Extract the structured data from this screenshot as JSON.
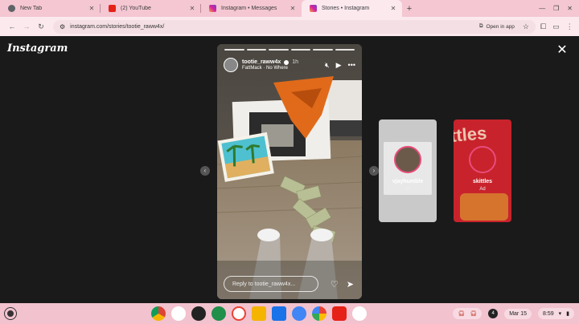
{
  "tabs": [
    {
      "title": "New Tab",
      "color": "#5f6368",
      "active": false
    },
    {
      "title": "(2) YouTube",
      "color": "#e62117",
      "active": false
    },
    {
      "title": "Instagram • Messages",
      "color": "#d6249f",
      "active": false
    },
    {
      "title": "Stories • Instagram",
      "color": "#d6249f",
      "active": true
    }
  ],
  "toolbar": {
    "url": "instagram.com/stories/tootie_raww4x/",
    "open_in_app": "Open in app"
  },
  "page": {
    "logo": "Instagram",
    "story": {
      "username": "tootie_raww4x",
      "time_ago": "1h",
      "music": "FattMack · No Where",
      "reply_placeholder": "Reply to tootie_raww4x..."
    },
    "previews": [
      {
        "name": "vjayhumble",
        "sub": "1h"
      },
      {
        "name": "skittles",
        "sub": "Ad"
      }
    ]
  },
  "shelf": {
    "date": "Mar 15",
    "time": "8:59",
    "notification_count": "4"
  },
  "colors": {
    "tab_strip": "#f4c7d2",
    "toolbar": "#fbe9ee",
    "page_bg": "#1a1a1a",
    "shelf": "#f2c2cf",
    "story_ring": "#e84b7a",
    "skittles_red": "#c8232c"
  }
}
